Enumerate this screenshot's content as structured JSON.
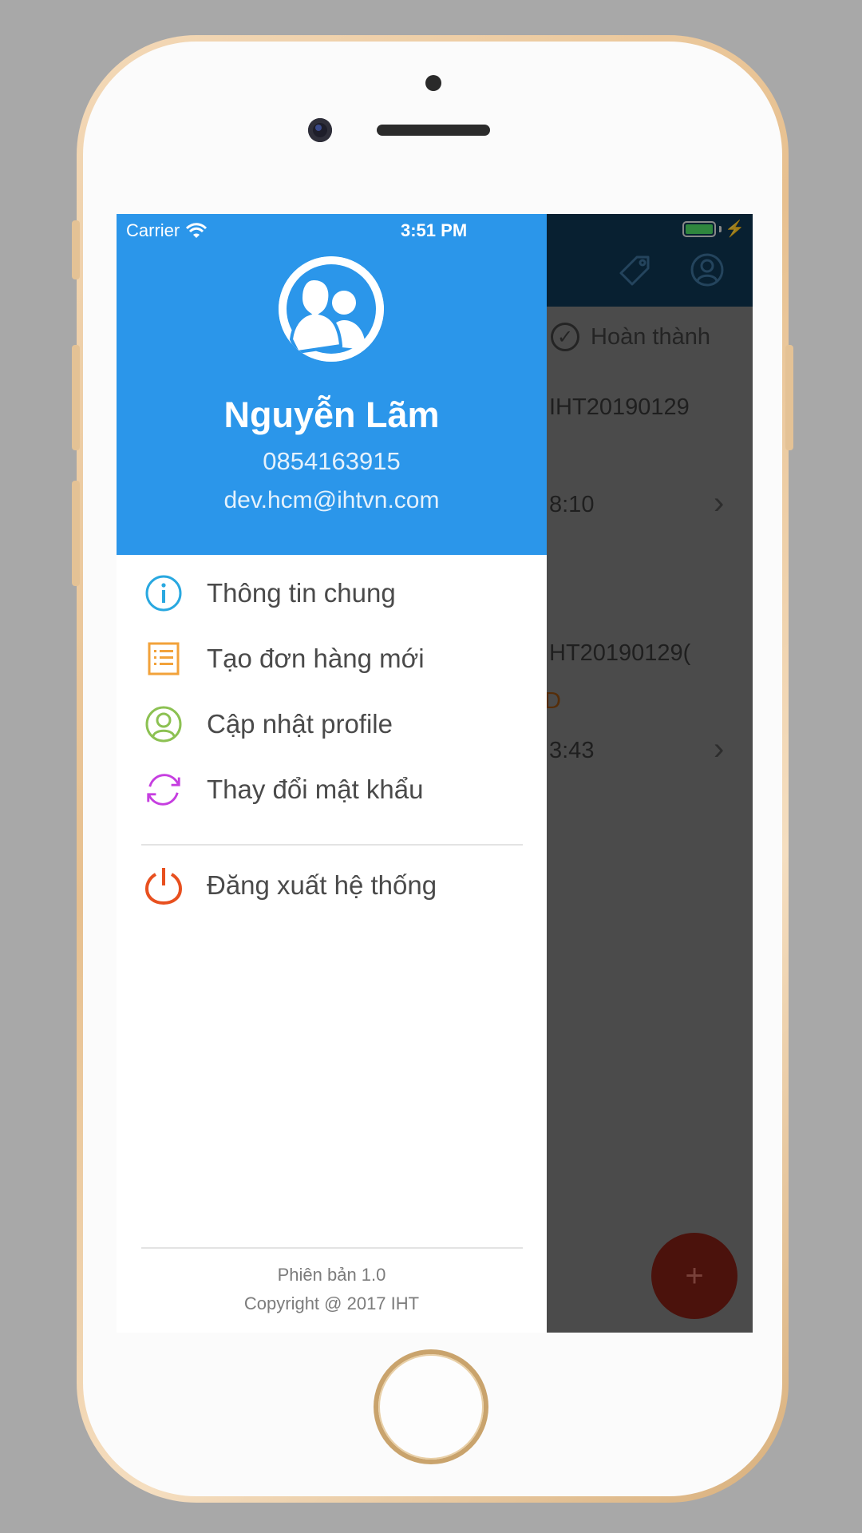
{
  "status_bar": {
    "carrier": "Carrier",
    "time": "3:51 PM"
  },
  "profile": {
    "name": "Nguyễn Lãm",
    "phone": "0854163915",
    "email": "dev.hcm@ihtvn.com"
  },
  "menu": [
    {
      "label": "Thông tin chung",
      "icon": "info-icon",
      "color": "#29a8e0"
    },
    {
      "label": "Tạo đơn hàng mới",
      "icon": "list-icon",
      "color": "#f2a23a"
    },
    {
      "label": "Cập nhật profile",
      "icon": "user-icon",
      "color": "#8cc152"
    },
    {
      "label": "Thay đổi mật khẩu",
      "icon": "refresh-icon",
      "color": "#c63ee0"
    }
  ],
  "logout": {
    "label": "Đăng xuất hệ thống",
    "icon": "power-icon",
    "color": "#e8501f"
  },
  "footer": {
    "version": "Phiên bản 1.0",
    "copyright": "Copyright @ 2017 IHT"
  },
  "background_app": {
    "filter_label": "Hoàn thành",
    "row1_code": "IHT20190129",
    "row1_time": "8:10",
    "row2_code": "HT20190129(",
    "row2_badge": "D",
    "row2_time": "3:43",
    "fab_label": "+"
  },
  "colors": {
    "header": "#2b96ea",
    "navbar": "#0d3550"
  }
}
